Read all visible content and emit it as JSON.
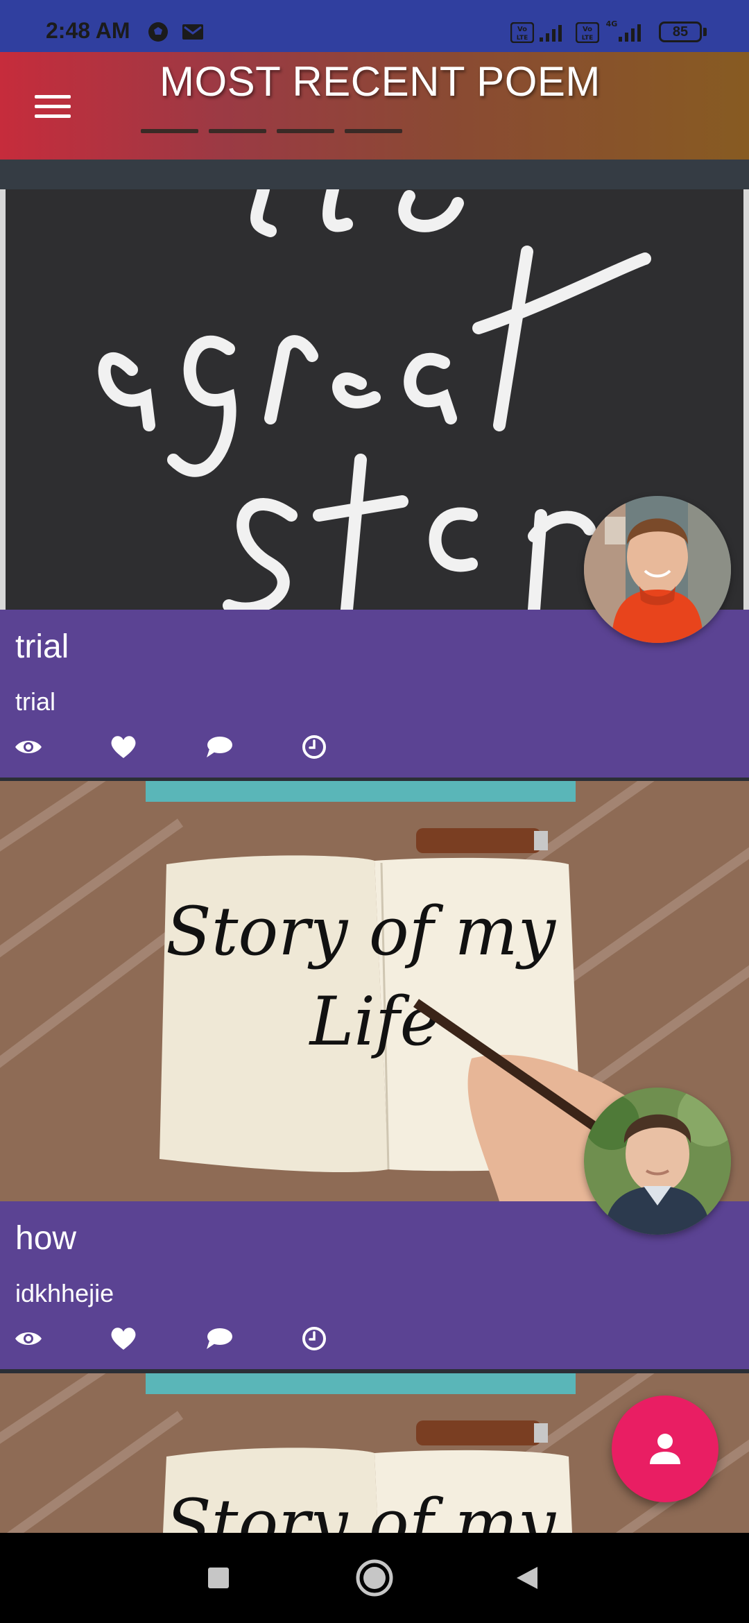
{
  "status_bar": {
    "time": "2:48 AM",
    "battery": "85",
    "icons": [
      "soccer-ball-icon",
      "mail-icon",
      "volte-icon",
      "signal-icon",
      "volte-icon",
      "signal-4g-icon"
    ]
  },
  "app_bar": {
    "title": "MOST RECENT POEM",
    "menu_icon": "menu-icon"
  },
  "posts": [
    {
      "title": "trial",
      "subtitle": "trial",
      "image_text": "a great story",
      "actions": [
        "eye-icon",
        "heart-icon",
        "comment-icon",
        "clock-icon"
      ]
    },
    {
      "title": "how",
      "subtitle": "idkhhejie",
      "image_text": "Story of my Life",
      "actions": [
        "eye-icon",
        "heart-icon",
        "comment-icon",
        "clock-icon"
      ]
    }
  ],
  "fab": {
    "icon": "person-icon"
  },
  "nav": {
    "icons": [
      "recents-icon",
      "home-icon",
      "back-icon"
    ]
  },
  "colors": {
    "status_bar": "#303f9f",
    "card_info": "#5b4393",
    "fab": "#e91e63",
    "nav_bar": "#000000"
  }
}
